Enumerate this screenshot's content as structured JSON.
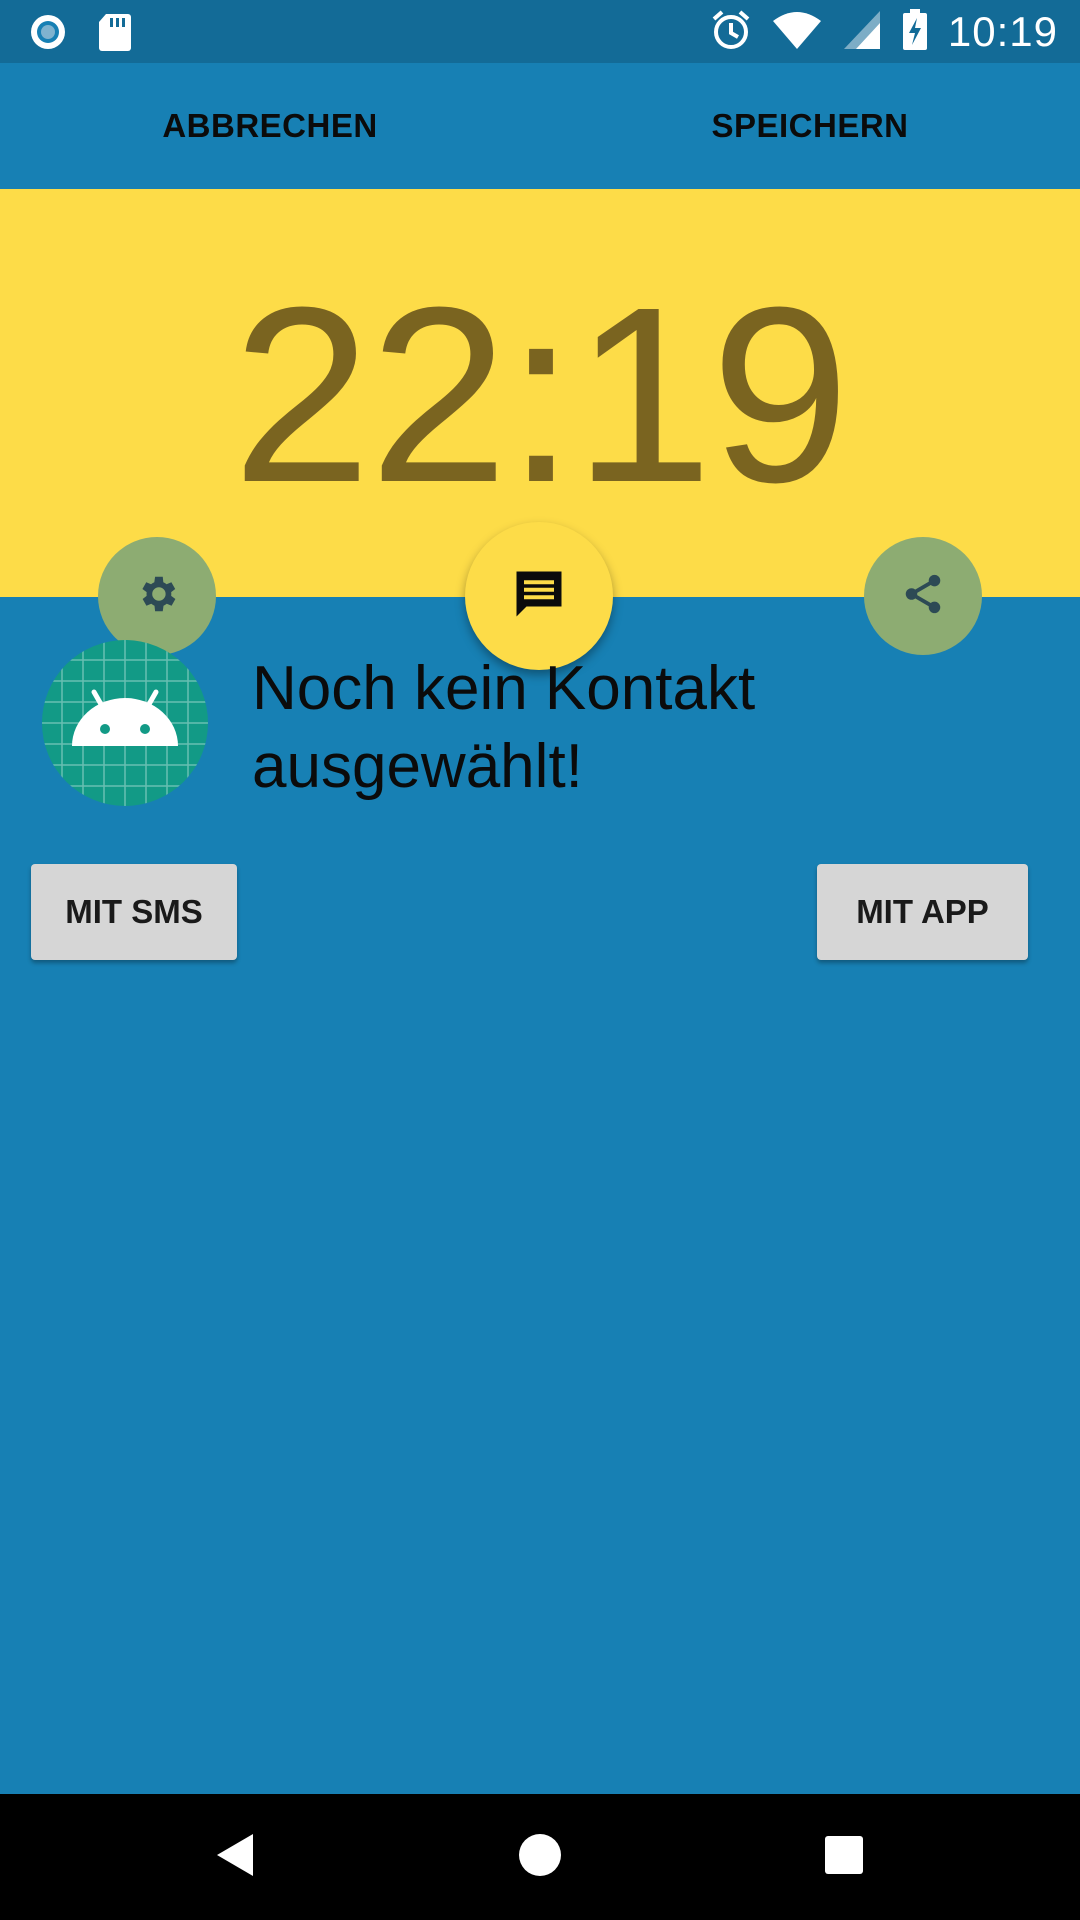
{
  "status_bar": {
    "time": "10:19",
    "left_icons": [
      "record-icon",
      "sd-card-icon"
    ],
    "right_icons": [
      "alarm-icon",
      "wifi-icon",
      "cell-signal-icon",
      "battery-charging-icon"
    ]
  },
  "actions": {
    "cancel_label": "ABBRECHEN",
    "save_label": "SPEICHERN"
  },
  "time_display": "22:19",
  "fabs": [
    "settings-icon",
    "message-icon",
    "share-icon"
  ],
  "contact": {
    "message": "Noch kein Kontakt ausgewählt!",
    "avatar_icon": "android-icon"
  },
  "buttons": {
    "sms_label": "MIT SMS",
    "app_label": "MIT APP"
  },
  "nav_bar": [
    "back-icon",
    "home-icon",
    "recents-icon"
  ],
  "colors": {
    "background": "#1780B4",
    "status_bar": "#136B97",
    "time_panel": "#FDDC48",
    "time_text": "#7A6420",
    "fab_muted": "#8DAC72",
    "button": "#D6D6D6"
  }
}
